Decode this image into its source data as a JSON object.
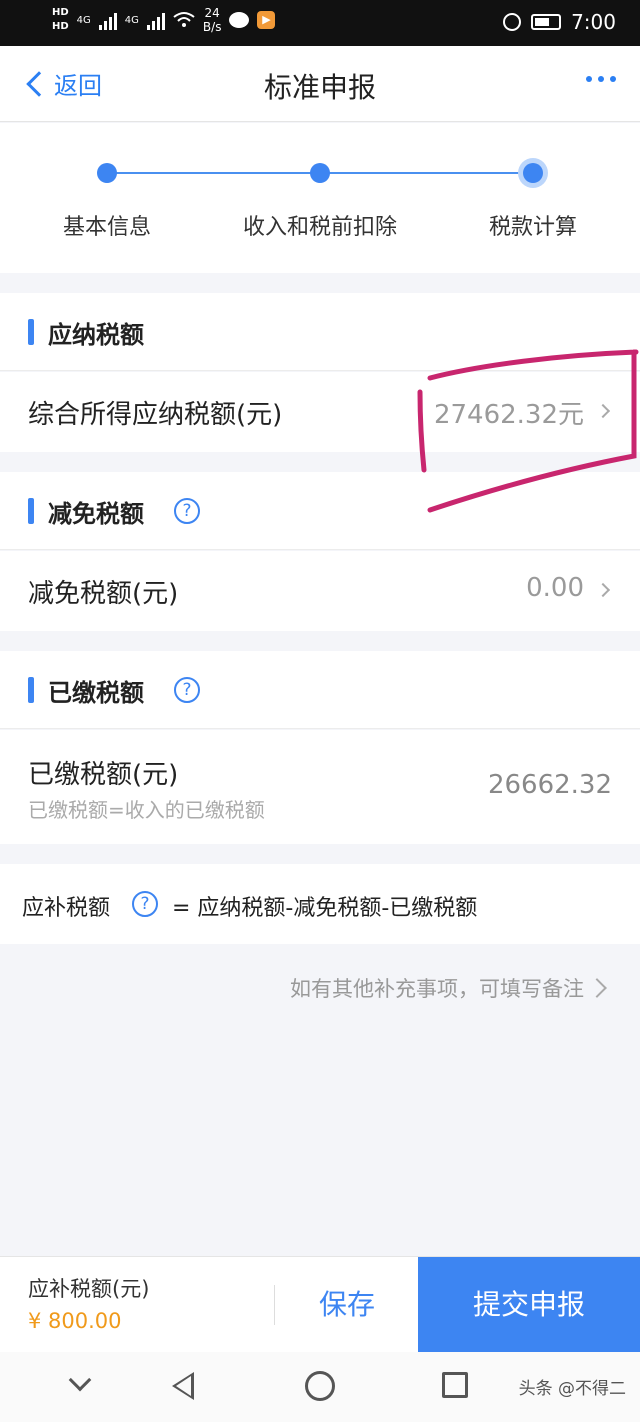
{
  "status_bar": {
    "hd1": "HD",
    "hd2": "HD",
    "net1": "4G",
    "net2": "4G",
    "speed_value": "24",
    "speed_unit": "B/s",
    "time": "7:00"
  },
  "nav": {
    "back_label": "返回",
    "title": "标准申报"
  },
  "steps": [
    {
      "label": "基本信息"
    },
    {
      "label": "收入和税前扣除"
    },
    {
      "label": "税款计算"
    }
  ],
  "sections": {
    "payable": {
      "title": "应纳税额",
      "row_label": "综合所得应纳税额(元)",
      "row_value": "27462.32元"
    },
    "reduction": {
      "title": "减免税额",
      "row_label": "减免税额(元)",
      "row_value": "0.00"
    },
    "paid": {
      "title": "已缴税额",
      "row_label": "已缴税额(元)",
      "row_sub": "已缴税额=收入的已缴税额",
      "row_value": "26662.32"
    }
  },
  "formula": {
    "label": "应补税额",
    "text": "= 应纳税额-减免税额-已缴税额"
  },
  "remark": "如有其他补充事项，可填写备注",
  "bottom": {
    "due_label": "应补税额(元)",
    "due_value": "¥ 800.00",
    "save_label": "保存",
    "submit_label": "提交申报"
  },
  "watermark": "头条 @不得二",
  "colors": {
    "accent": "#3d85f2",
    "amount": "#f09a1b",
    "annotation": "#c8266e"
  }
}
